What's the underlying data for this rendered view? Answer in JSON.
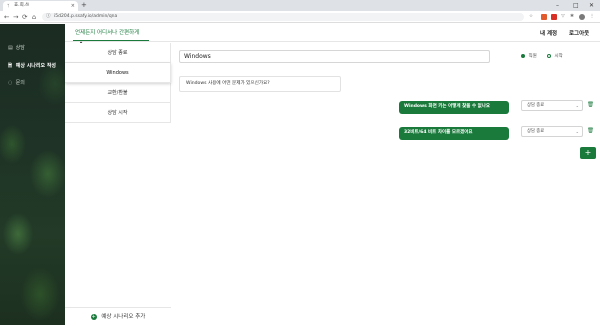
{
  "browser": {
    "tab_title": "효.희.쓰",
    "tab_favicon": "ᛉ",
    "tab_close": "×",
    "new_tab": "+",
    "url": "i5d204.p.ssafy.io/admin/qna",
    "nav": {
      "back": "←",
      "forward": "→",
      "reload": "⟳",
      "home": "⌂"
    },
    "window_controls": {
      "minimize": "–",
      "maximize": "□",
      "close": "✕"
    }
  },
  "sidebar": {
    "items": [
      {
        "icon": "list-icon",
        "glyph": "▤",
        "label": "상담"
      },
      {
        "icon": "file-icon",
        "glyph": "🗎",
        "label": "예상 시나리오 작성"
      },
      {
        "icon": "chat-icon",
        "glyph": "◌",
        "label": "문의"
      }
    ]
  },
  "header": {
    "brand": "언제든지 어디서나 간편하게",
    "account": "내 계정",
    "logout": "로그아웃"
  },
  "scenarios": {
    "items": [
      "상담 종료",
      "Windows",
      "교환/환불",
      "상담 시작"
    ],
    "selected_index": 1,
    "add_label": "예상 시나리오 추가",
    "add_icon": "+"
  },
  "editor": {
    "title_value": "Windows",
    "radio_options": [
      {
        "label": "직원",
        "checked": true
      },
      {
        "label": "시작",
        "checked": false
      }
    ],
    "question": "Windows 사용에 어떤 문제가 있으신가요?",
    "answers": [
      {
        "text": "Windows 화면 키는 어떻게 찾을 수 없나요",
        "next": "상담 종료"
      },
      {
        "text": "32비트/64 비트 차이를 모르겠어요",
        "next": "상담 종료"
      }
    ],
    "select_chevron": "⌄",
    "delete_icon": "🗑",
    "add_button": "+"
  },
  "colors": {
    "accent": "#1a7a3c"
  }
}
